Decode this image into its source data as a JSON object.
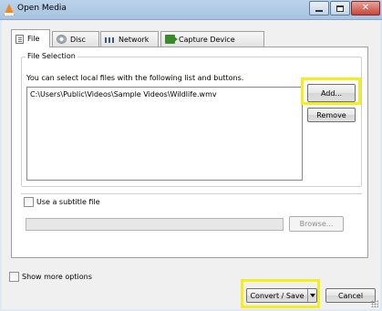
{
  "window": {
    "title": "Open Media",
    "buttons": {
      "minimize_icon": "minimize-icon",
      "maximize_icon": "maximize-icon",
      "close_icon": "close-icon",
      "close_glyph": "✕"
    },
    "app_icon": "vlc-cone-icon"
  },
  "tabs": [
    {
      "label": "File",
      "icon": "file-icon",
      "active": true
    },
    {
      "label": "Disc",
      "icon": "disc-icon",
      "active": false
    },
    {
      "label": "Network",
      "icon": "network-icon",
      "active": false
    },
    {
      "label": "Capture Device",
      "icon": "capture-device-icon",
      "active": false
    }
  ],
  "file_selection": {
    "legend": "File Selection",
    "description": "You can select local files with the following list and buttons.",
    "files": [
      "C:\\Users\\Public\\Videos\\Sample Videos\\Wildlife.wmv"
    ],
    "add_label": "Add...",
    "remove_label": "Remove"
  },
  "subtitle": {
    "label": "Use a subtitle file",
    "checked": false,
    "path_value": "",
    "browse_label": "Browse...",
    "enabled": false
  },
  "footer": {
    "show_more_label": "Show more options",
    "show_more_checked": false,
    "convert_label": "Convert / Save",
    "cancel_label": "Cancel"
  },
  "highlight_color": "#f4ef1c"
}
